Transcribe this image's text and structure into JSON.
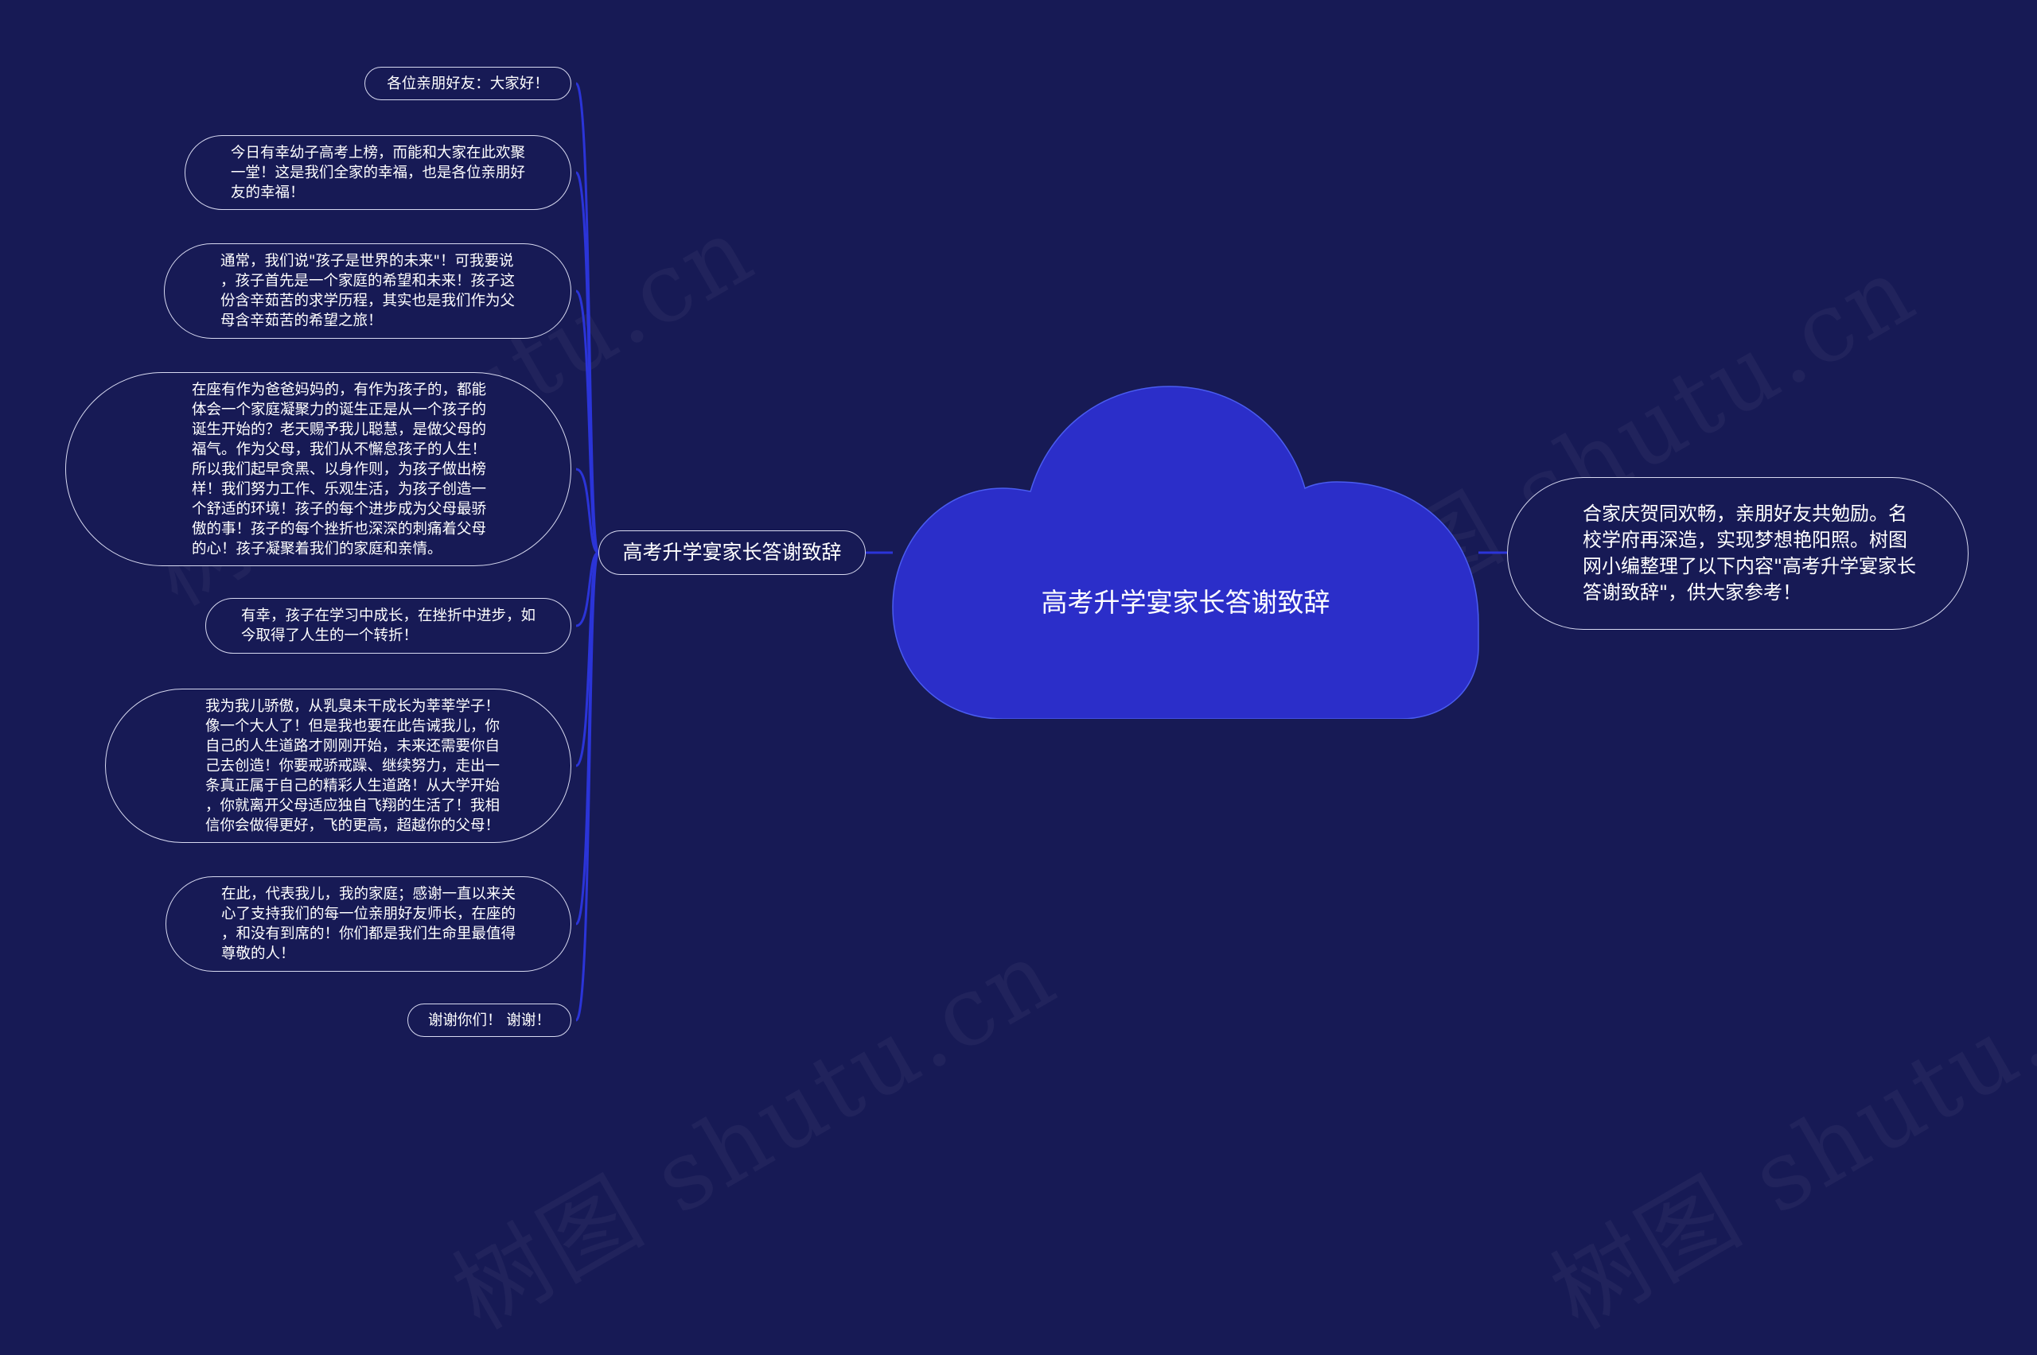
{
  "root": {
    "title": "高考升学宴家长答谢致辞"
  },
  "subtopic": {
    "label": "高考升学宴家长答谢致辞"
  },
  "right_note": {
    "text": "合家庆贺同欢畅，亲朋好友共勉励。名校学府再深造，实现梦想艳阳照。树图网小编整理了以下内容\"高考升学宴家长答谢致辞\"，供大家参考！"
  },
  "leaves": [
    {
      "text": "各位亲朋好友：大家好！"
    },
    {
      "text": "今日有幸幼子高考上榜，而能和大家在此欢聚\n一堂！这是我们全家的幸福，也是各位亲朋好\n友的幸福！"
    },
    {
      "text": "通常，我们说\"孩子是世界的未来\"！可我要说\n，孩子首先是一个家庭的希望和未来！孩子这\n份含辛茹苦的求学历程，其实也是我们作为父\n母含辛茹苦的希望之旅！"
    },
    {
      "text": "在座有作为爸爸妈妈的，有作为孩子的，都能\n体会一个家庭凝聚力的诞生正是从一个孩子的\n诞生开始的？老天赐予我儿聪慧，是做父母的\n福气。作为父母，我们从不懈怠孩子的人生！\n所以我们起早贪黑、以身作则，为孩子做出榜\n样！我们努力工作、乐观生活，为孩子创造一\n个舒适的环境！孩子的每个进步成为父母最骄\n傲的事！孩子的每个挫折也深深的刺痛着父母\n的心！孩子凝聚着我们的家庭和亲情。"
    },
    {
      "text": "有幸，孩子在学习中成长，在挫折中进步，如\n今取得了人生的一个转折！"
    },
    {
      "text": "我为我儿骄傲，从乳臭未干成长为莘莘学子！\n像一个大人了！但是我也要在此告诫我儿，你\n自己的人生道路才刚刚开始，未来还需要你自\n己去创造！你要戒骄戒躁、继续努力，走出一\n条真正属于自己的精彩人生道路！从大学开始\n，你就离开父母适应独自飞翔的生活了！我相\n信你会做得更好，飞的更高，超越你的父母！"
    },
    {
      "text": "在此，代表我儿，我的家庭；感谢一直以来关\n心了支持我们的每一位亲朋好友师长，在座的\n，和没有到席的！你们都是我们生命里最值得\n尊敬的人！"
    },
    {
      "text": "谢谢你们！  谢谢！"
    }
  ],
  "watermark": {
    "text": "树图 shutu.cn"
  },
  "colors": {
    "background": "#171a55",
    "cloud_fill": "#2b2ec9",
    "cloud_stroke": "#4a5cf0",
    "edge": "#2b34d8",
    "node_border": "#d7d9f0",
    "text": "#ffffff"
  }
}
